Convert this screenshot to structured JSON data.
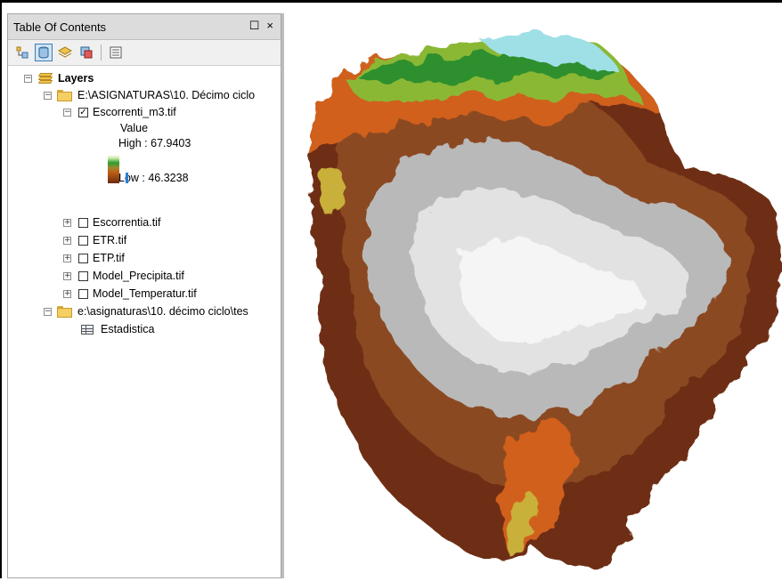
{
  "toc": {
    "title": "Table Of Contents",
    "restore_glyph": "☐",
    "close_glyph": "×",
    "toolbar": [
      "list-by-drawing-order-icon",
      "list-by-source-icon",
      "list-by-visibility-icon",
      "list-by-selection-icon",
      "options-icon"
    ]
  },
  "tree": {
    "root": "Layers",
    "folder1": "E:\\ASIGNATURAS\\10. Décimo ciclo",
    "active_layer": "Escorrenti_m3.tif",
    "legend_heading": "Value",
    "legend_high": "High : 67.9403",
    "legend_low": "Low : 46.3238",
    "layers": [
      "Escorrentia.tif",
      "ETR.tif",
      "ETP.tif",
      "Model_Precipita.tif",
      "Model_Temperatur.tif"
    ],
    "folder2": "e:\\asignaturas\\10. décimo ciclo\\tes",
    "table": "Estadistica"
  },
  "colors": {
    "ramp": [
      "#ffffff",
      "#2d9c2d",
      "#c06018",
      "#6b2a10"
    ],
    "low_marker": "#2a7fd4"
  }
}
